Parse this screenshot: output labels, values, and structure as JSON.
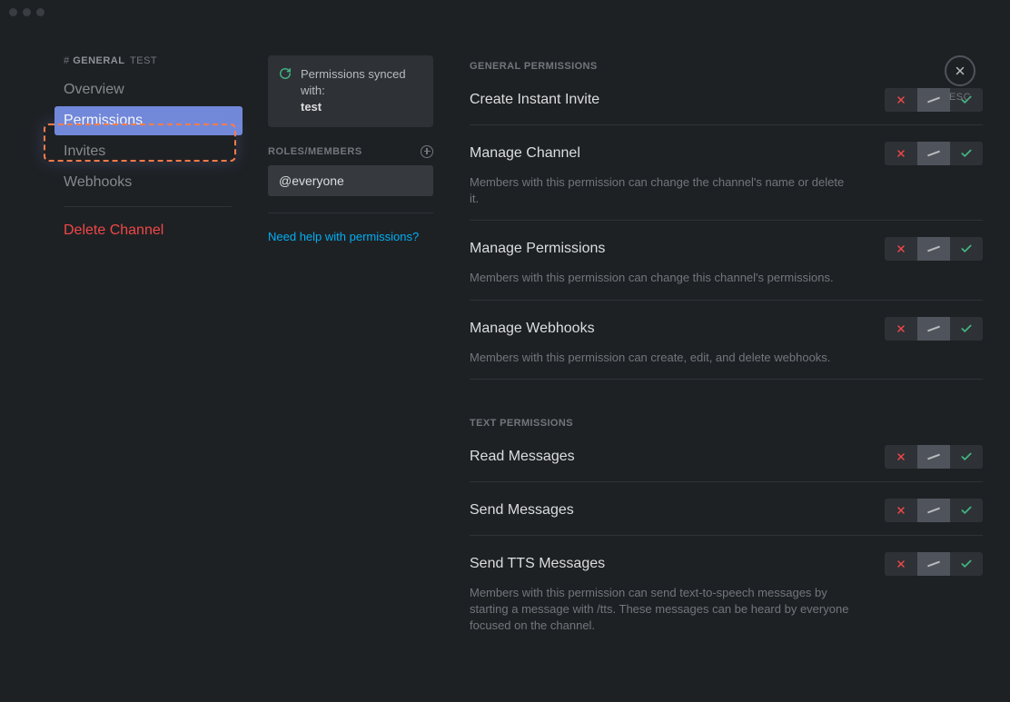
{
  "sidebar": {
    "hash": "#",
    "channel_name": "GENERAL",
    "channel_suffix": "TEST",
    "items": {
      "overview": "Overview",
      "permissions": "Permissions",
      "invites": "Invites",
      "webhooks": "Webhooks",
      "delete": "Delete Channel"
    }
  },
  "middle": {
    "sync_label": "Permissions synced with:",
    "sync_role": "test",
    "roles_header": "ROLES/MEMBERS",
    "role_item": "@everyone",
    "help_link": "Need help with permissions?"
  },
  "main": {
    "section_general": "GENERAL PERMISSIONS",
    "section_text": "TEXT PERMISSIONS",
    "perms": {
      "create_invite": {
        "title": "Create Instant Invite"
      },
      "manage_channel": {
        "title": "Manage Channel",
        "desc": "Members with this permission can change the channel's name or delete it."
      },
      "manage_permissions": {
        "title": "Manage Permissions",
        "desc": "Members with this permission can change this channel's permissions."
      },
      "manage_webhooks": {
        "title": "Manage Webhooks",
        "desc": "Members with this permission can create, edit, and delete webhooks."
      },
      "read_messages": {
        "title": "Read Messages"
      },
      "send_messages": {
        "title": "Send Messages"
      },
      "send_tts": {
        "title": "Send TTS Messages",
        "desc": "Members with this permission can send text-to-speech messages by starting a message with /tts. These messages can be heard by everyone focused on the channel."
      }
    }
  },
  "esc": {
    "label": "ESC"
  }
}
